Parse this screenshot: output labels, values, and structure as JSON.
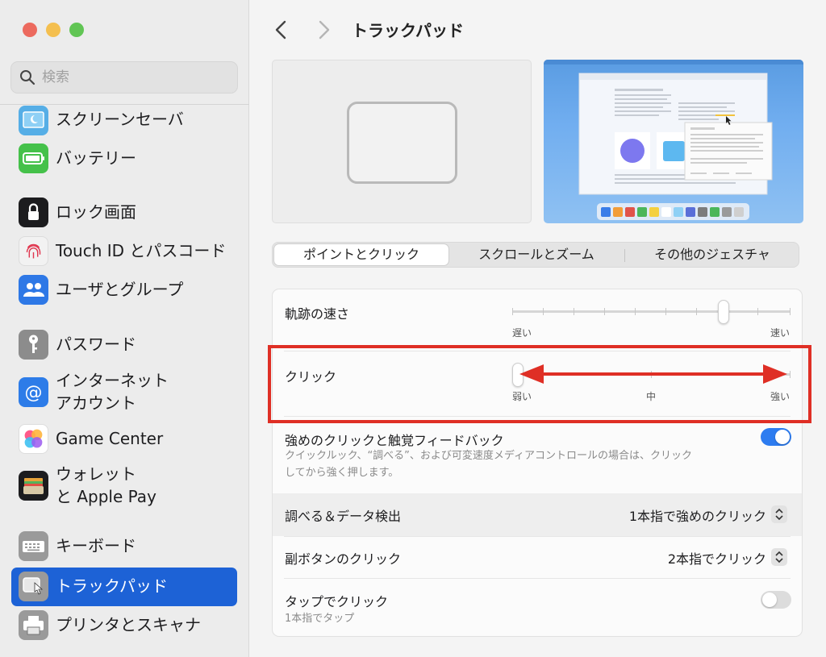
{
  "window": {
    "traffic_lights": {
      "close": "#ec6a5e",
      "minimize": "#f4bf4f",
      "zoom": "#61c554"
    }
  },
  "sidebar": {
    "search": {
      "placeholder": "検索"
    },
    "items": [
      {
        "label": "スクリーンセーバ",
        "icon": "screensaver-icon",
        "color": "#56aee6"
      },
      {
        "label": "バッテリー",
        "icon": "battery-icon",
        "color": "#45c14a"
      },
      {
        "label": "ロック画面",
        "icon": "lock-icon",
        "color": "#1c1c1e"
      },
      {
        "label": "Touch ID とパスコード",
        "icon": "fingerprint-icon",
        "color": "#f2f2f2"
      },
      {
        "label": "ユーザとグループ",
        "icon": "users-icon",
        "color": "#2e78e6"
      },
      {
        "label": "パスワード",
        "icon": "key-icon",
        "color": "#8c8c8c"
      },
      {
        "label_line1": "インターネット",
        "label_line2": "アカウント",
        "icon": "at-sign-icon",
        "color": "#2d7ce8"
      },
      {
        "label": "Game Center",
        "icon": "game-center-icon",
        "color": "#ffffff"
      },
      {
        "label_line1": "ウォレット",
        "label_line2": "と Apple Pay",
        "icon": "wallet-icon",
        "color": "#1c1c1e"
      },
      {
        "label": "キーボード",
        "icon": "keyboard-icon",
        "color": "#9a9a9a"
      },
      {
        "label": "トラックパッド",
        "icon": "trackpad-icon",
        "color": "#9a9a9a",
        "selected": true
      },
      {
        "label": "プリンタとスキャナ",
        "icon": "printer-icon",
        "color": "#9a9a9a"
      }
    ],
    "selection_color": "#1d62d6"
  },
  "toolbar": {
    "title": "トラックパッド"
  },
  "tabs": [
    {
      "label": "ポイントとクリック",
      "active": true
    },
    {
      "label": "スクロールとズーム",
      "active": false
    },
    {
      "label": "その他のジェスチャ",
      "active": false
    }
  ],
  "settings": {
    "tracking_speed": {
      "label": "軌跡の速さ",
      "min_label": "遅い",
      "max_label": "速い",
      "value": 0.77
    },
    "click": {
      "label": "クリック",
      "min_label": "弱い",
      "mid_label": "中",
      "max_label": "強い",
      "value": 0.0
    },
    "force_click": {
      "label": "強めのクリックと触覚フィードバック",
      "description_line1": "クイックルック、“調べる”、および可変速度メディアコントロールの場合は、クリック",
      "description_line2": "してから強く押します。",
      "on": true
    },
    "lookup": {
      "label": "調べる＆データ検出",
      "value": "1本指で強めのクリック"
    },
    "secondary_click": {
      "label": "副ボタンのクリック",
      "value": "2本指でクリック"
    },
    "tap_to_click": {
      "label": "タップでクリック",
      "description": "1本指でタップ",
      "on": false
    }
  },
  "colors": {
    "accent": "#2d7cf0",
    "annotation": "#df2f25"
  }
}
